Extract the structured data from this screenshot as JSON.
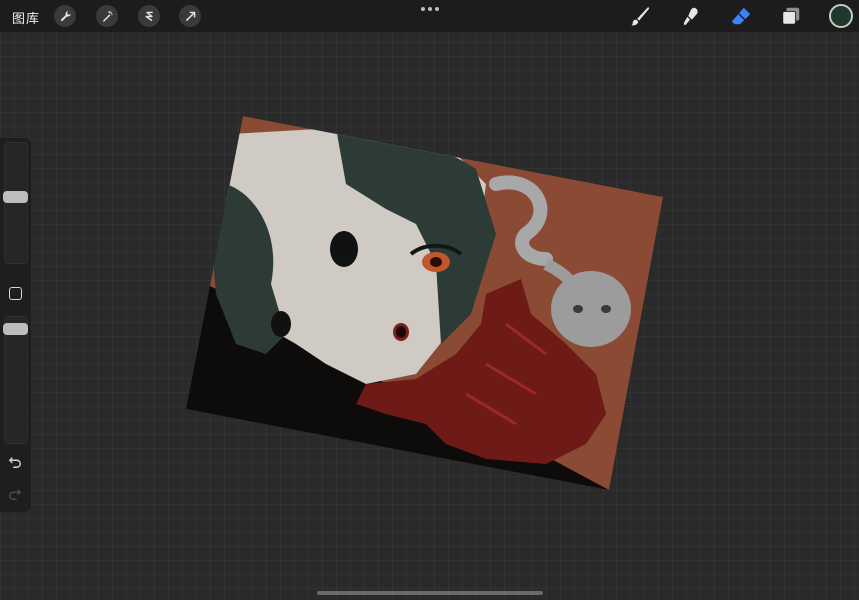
{
  "toolbar": {
    "gallery_label": "图库",
    "left_tools": [
      {
        "icon": "wrench-icon",
        "name": "actions-button"
      },
      {
        "icon": "magic-wand-icon",
        "name": "adjustments-button"
      },
      {
        "icon": "selection-icon",
        "name": "selection-button"
      },
      {
        "icon": "transform-arrow-icon",
        "name": "transform-button"
      }
    ],
    "right_tools": [
      {
        "icon": "brush-icon",
        "name": "brush-button",
        "active": false
      },
      {
        "icon": "smudge-icon",
        "name": "smudge-button",
        "active": false
      },
      {
        "icon": "eraser-icon",
        "name": "eraser-button",
        "active": true
      },
      {
        "icon": "layers-icon",
        "name": "layers-button",
        "active": false
      }
    ],
    "active_tool": "eraser",
    "current_color": "#1d3a2c",
    "accent_color": "#3b82f6"
  },
  "sidebar": {
    "brush_size_level": 0.45,
    "opacity_level": 0.9,
    "icons": [
      "modify-icon",
      "undo-icon",
      "redo-icon"
    ]
  },
  "canvas": {
    "description_colors": {
      "background": "#8a4a33",
      "skin": "#cfcac3",
      "hair": "#2c3b36",
      "hand": "#6e1a16",
      "shadow": "#0e0c0b"
    }
  }
}
